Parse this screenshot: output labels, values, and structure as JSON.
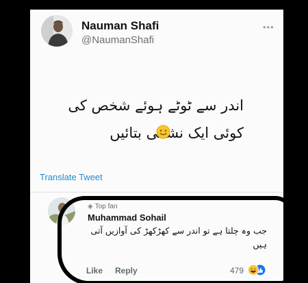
{
  "tweet": {
    "display_name": "Nauman Shafi",
    "handle": "@NaumanShafi",
    "more_icon": "more-dots-icon",
    "text_line1": "اندر سے ٹوٹے ہوئے شخص کی",
    "text_line2": "کوئی ایک نشانی بتائیں",
    "emoji": "slightly-smiling-face-icon",
    "translate_label": "Translate Tweet"
  },
  "reply": {
    "badge_icon": "diamond-icon",
    "badge_label": "Top fan",
    "name": "Muhammad Sohail",
    "text": "جب وہ چلتا ہے تو اندر سے   کھڑکھڑ کی آوازیں آتی ہیں",
    "like_label": "Like",
    "reply_label": "Reply",
    "reaction_count": "479",
    "reaction_icons": [
      "laugh-reaction-icon",
      "like-reaction-icon"
    ]
  },
  "colors": {
    "background": "#000000",
    "card": "#fbfbfb",
    "link": "#1f8ad1",
    "muted": "#6b6f73"
  }
}
